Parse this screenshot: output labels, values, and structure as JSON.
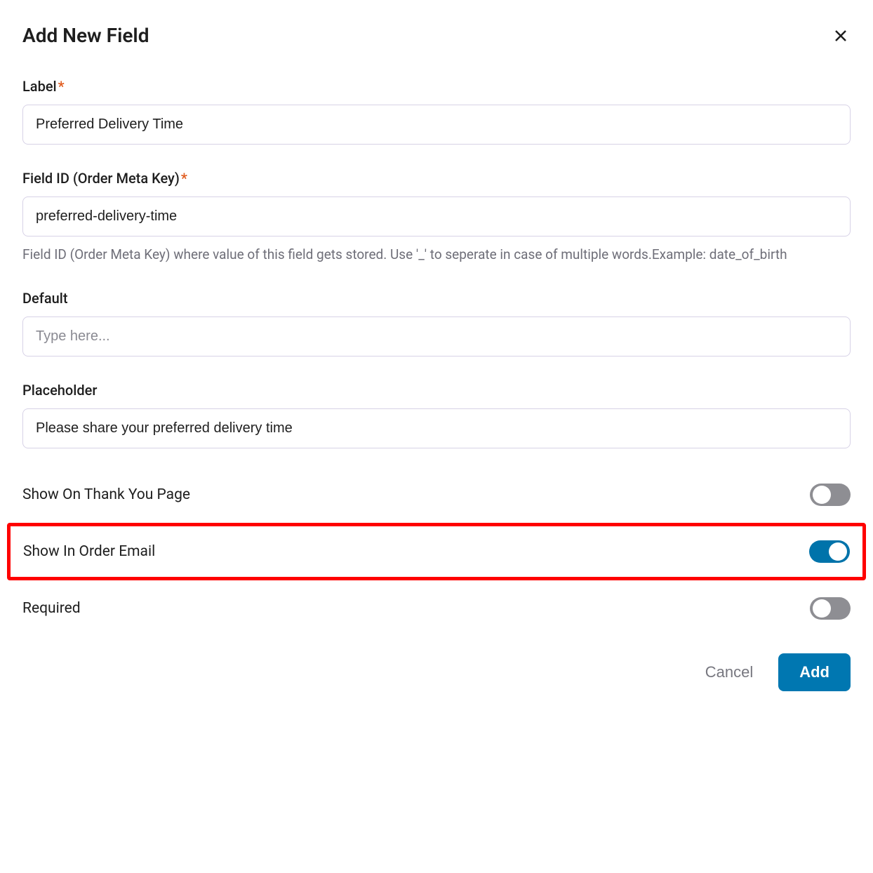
{
  "header": {
    "title": "Add New Field"
  },
  "fields": {
    "label": {
      "label": "Label",
      "required": true,
      "value": "Preferred Delivery Time"
    },
    "field_id": {
      "label": "Field ID (Order Meta Key)",
      "required": true,
      "value": "preferred-delivery-time",
      "help": "Field ID (Order Meta Key) where value of this field gets stored. Use '_' to seperate in case of multiple words.Example: date_of_birth"
    },
    "default": {
      "label": "Default",
      "placeholder": "Type here...",
      "value": ""
    },
    "placeholder": {
      "label": "Placeholder",
      "value": "Please share your preferred delivery time"
    }
  },
  "toggles": {
    "thank_you": {
      "label": "Show On Thank You Page",
      "on": false
    },
    "order_email": {
      "label": "Show In Order Email",
      "on": true
    },
    "required": {
      "label": "Required",
      "on": false
    }
  },
  "footer": {
    "cancel": "Cancel",
    "add": "Add"
  }
}
